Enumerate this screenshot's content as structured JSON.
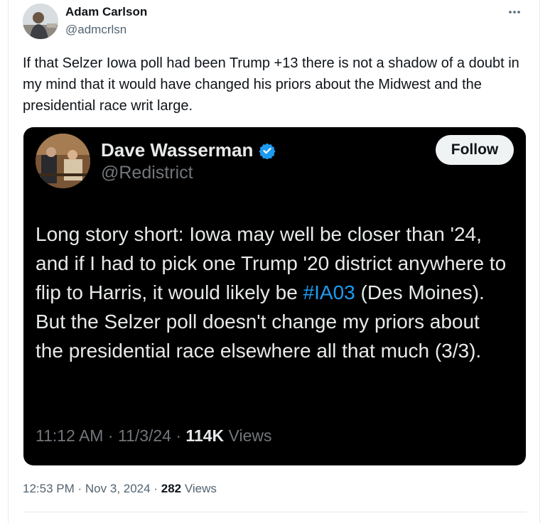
{
  "author": {
    "name": "Adam Carlson",
    "handle": "@admcrlsn"
  },
  "tweet": {
    "text": "If that Selzer Iowa poll had been Trump +13 there is not a shadow of a doubt in my mind that it would have changed his priors about the Midwest and the presidential race writ large.",
    "time": "12:53 PM",
    "date": "Nov 3, 2024",
    "views_count": "282",
    "views_label": "Views"
  },
  "quoted": {
    "name": "Dave Wasserman",
    "handle": "@Redistrict",
    "follow_label": "Follow",
    "text_before": "Long story short: Iowa may well be closer than '24, and if I had to pick one Trump '20 district anywhere to flip to Harris, it would likely be ",
    "hashtag": "#IA03",
    "text_after": " (Des Moines). But the Selzer poll doesn't change my priors about the presidential race elsewhere all that much (3/3).",
    "time": "11:12 AM",
    "date": "11/3/24",
    "views_count": "114K",
    "views_label": "Views"
  },
  "icons": {
    "more": "more-horizontal-icon",
    "verified": "verified-badge-icon"
  },
  "colors": {
    "accent": "#1d9bf0",
    "quote_bg": "#000000",
    "secondary_text": "#536471"
  }
}
